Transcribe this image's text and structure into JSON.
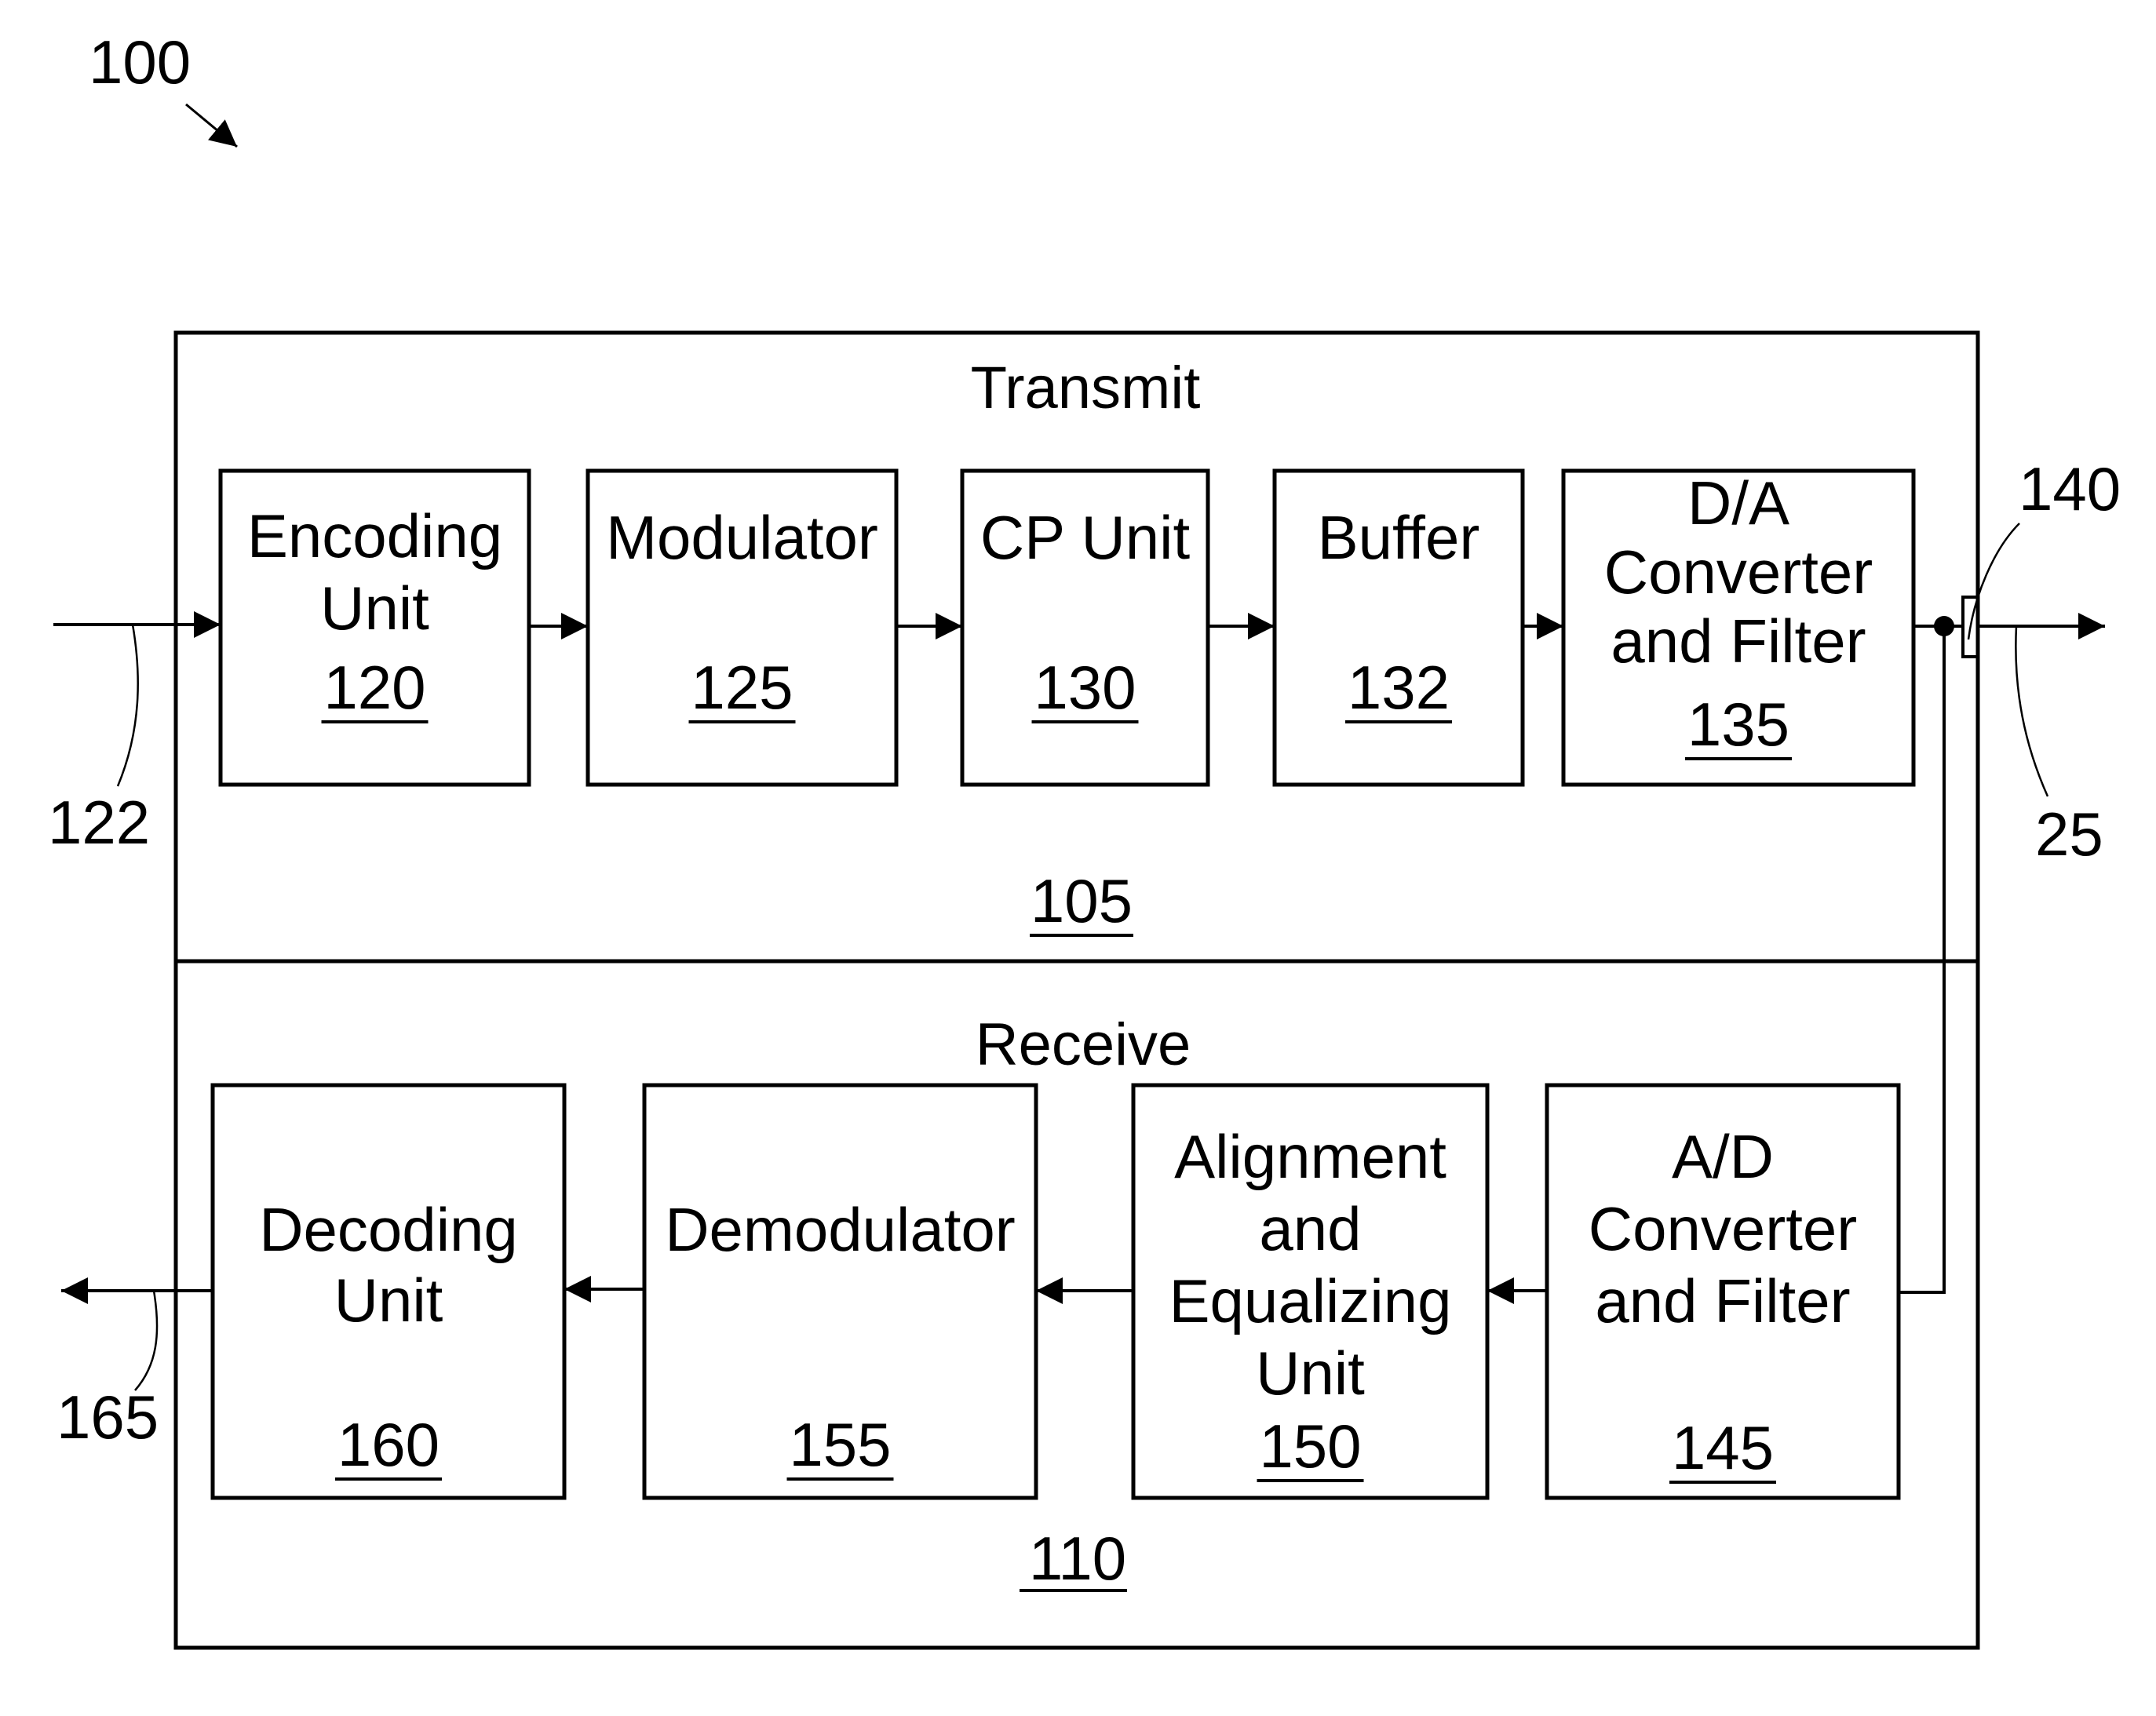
{
  "figure": {
    "reference": "100",
    "colors": {
      "ink": "#000000",
      "paper": "#ffffff"
    }
  },
  "transmit": {
    "title": "Transmit",
    "reference": "105",
    "blocks": [
      {
        "id": "encoding-unit",
        "lines": [
          "Encoding",
          "Unit"
        ],
        "ref": "120"
      },
      {
        "id": "modulator",
        "lines": [
          "Modulator"
        ],
        "ref": "125"
      },
      {
        "id": "cp-unit",
        "lines": [
          "CP Unit"
        ],
        "ref": "130"
      },
      {
        "id": "buffer",
        "lines": [
          "Buffer"
        ],
        "ref": "132"
      },
      {
        "id": "da-converter-filter",
        "lines": [
          "D/A",
          "Converter",
          "and Filter"
        ],
        "ref": "135"
      }
    ]
  },
  "receive": {
    "title": "Receive",
    "reference": "110",
    "blocks": [
      {
        "id": "decoding-unit",
        "lines": [
          "Decoding",
          "Unit"
        ],
        "ref": "160"
      },
      {
        "id": "demodulator",
        "lines": [
          "Demodulator"
        ],
        "ref": "155"
      },
      {
        "id": "alignment-equalizing-unit",
        "lines": [
          "Alignment",
          "and",
          "Equalizing",
          "Unit"
        ],
        "ref": "150"
      },
      {
        "id": "ad-converter-filter",
        "lines": [
          "A/D",
          "Converter",
          "and Filter"
        ],
        "ref": "145"
      }
    ]
  },
  "signals": {
    "input": "122",
    "output": "165",
    "connector": "140",
    "channel": "25"
  }
}
